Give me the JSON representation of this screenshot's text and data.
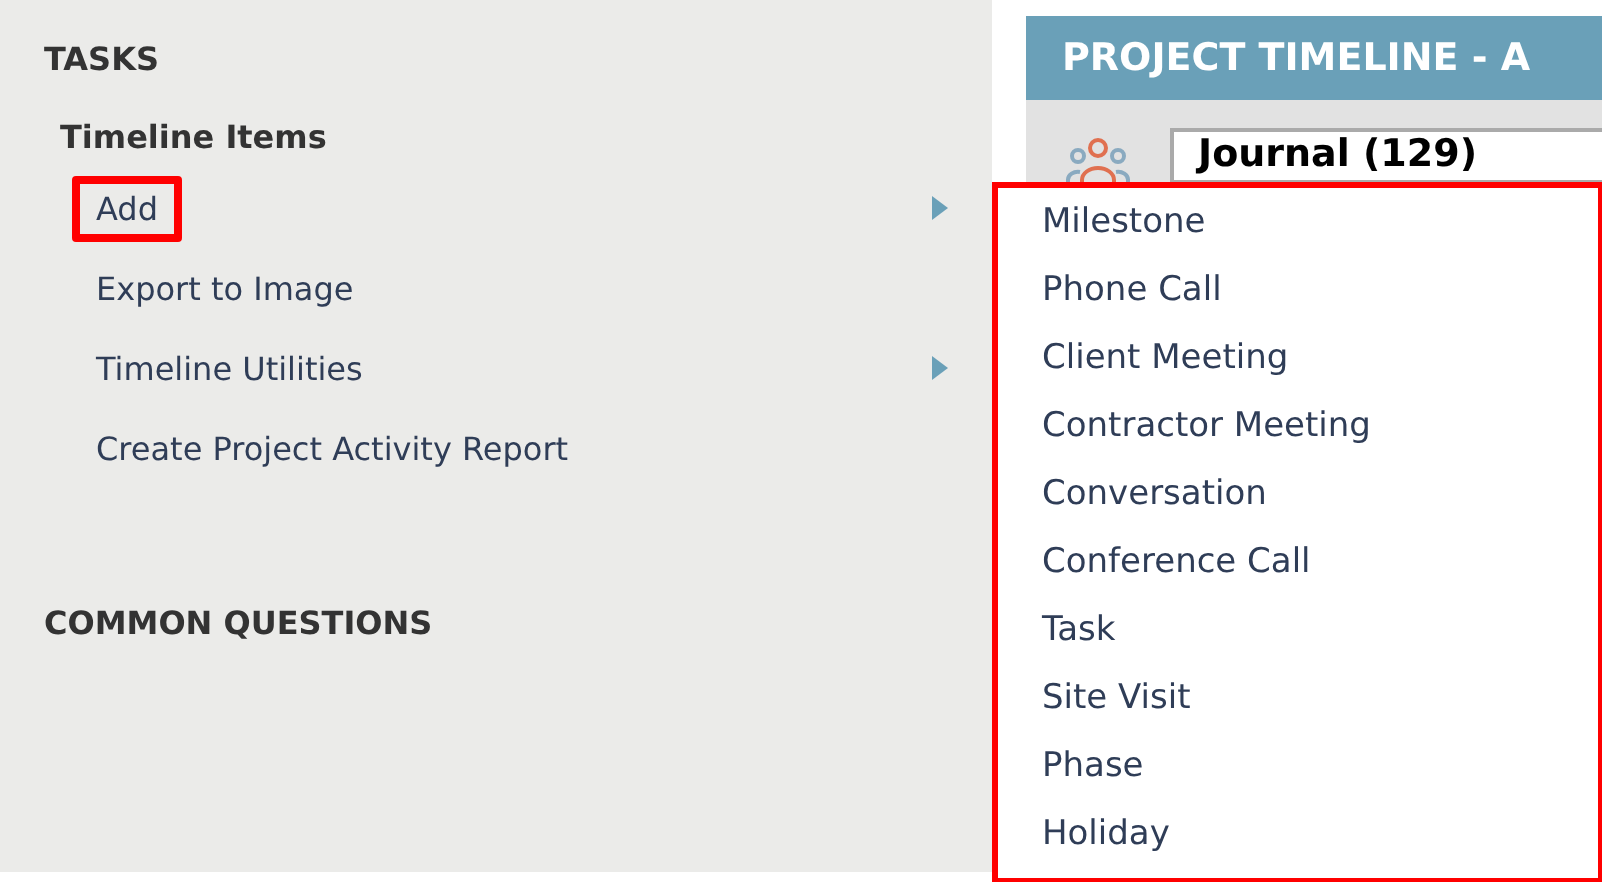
{
  "tasks": {
    "title": "TASKS",
    "group_title": "Timeline Items",
    "items": [
      {
        "label": "Add",
        "has_submenu": true,
        "highlighted": true
      },
      {
        "label": "Export to Image",
        "has_submenu": false,
        "highlighted": false
      },
      {
        "label": "Timeline Utilities",
        "has_submenu": true,
        "highlighted": false
      },
      {
        "label": "Create Project Activity Report",
        "has_submenu": false,
        "highlighted": false
      }
    ]
  },
  "common_questions": {
    "title": "COMMON QUESTIONS"
  },
  "panel": {
    "title": "PROJECT TIMELINE - A",
    "journal_field": {
      "value": "Journal (129)"
    }
  },
  "submenu": {
    "highlighted": true,
    "items": [
      "Milestone",
      "Phone Call",
      "Client Meeting",
      "Contractor Meeting",
      "Conversation",
      "Conference Call",
      "Task",
      "Site Visit",
      "Phase",
      "Holiday"
    ]
  }
}
